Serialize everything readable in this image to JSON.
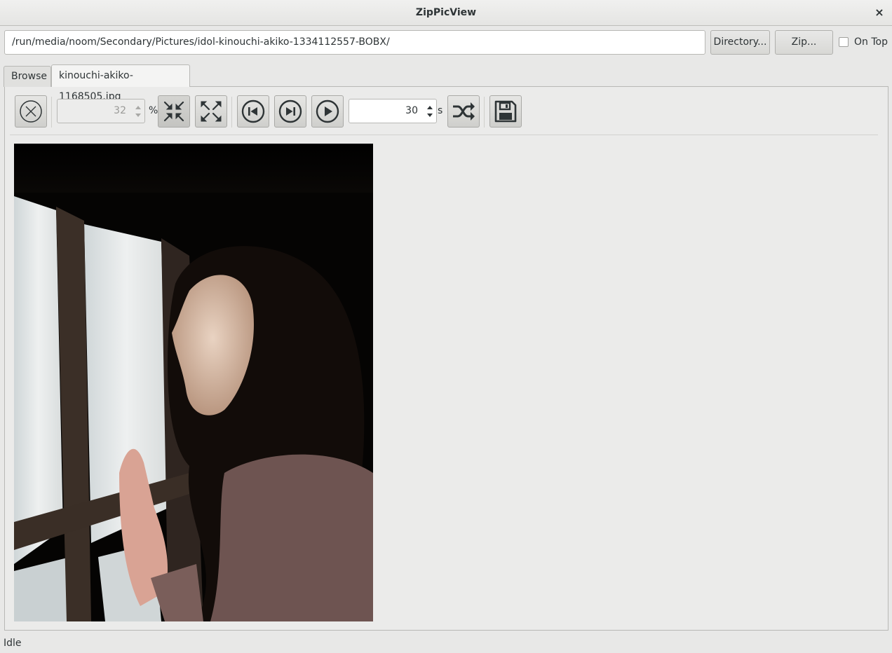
{
  "window": {
    "title": "ZipPicView",
    "close_glyph": "×"
  },
  "path_bar": {
    "value": "/run/media/noom/Secondary/Pictures/idol-kinouchi-akiko-1334112557-BOBX/"
  },
  "buttons": {
    "directory": "Directory...",
    "zip": "Zip..."
  },
  "on_top": {
    "label": "On Top",
    "checked": false
  },
  "tabs": [
    {
      "label": "Browse",
      "active": false
    },
    {
      "label": "kinouchi-akiko-1168505.jpg",
      "active": true
    }
  ],
  "toolbar": {
    "zoom": {
      "value": "32",
      "unit": "%",
      "enabled": false
    },
    "interval": {
      "value": "30",
      "unit": "s"
    },
    "icons": [
      "close-circle-icon",
      "fit-to-window-icon",
      "actual-size-icon",
      "previous-icon",
      "next-icon",
      "play-icon",
      "shuffle-icon",
      "save-icon"
    ]
  },
  "image": {
    "description_icon": "photo-viewer-image"
  },
  "status": {
    "text": "Idle"
  },
  "colors": {
    "window_bg": "#e8e8e7",
    "titlebar": "#f0f0ef",
    "border": "#b8b8b5",
    "text": "#2e3436"
  }
}
